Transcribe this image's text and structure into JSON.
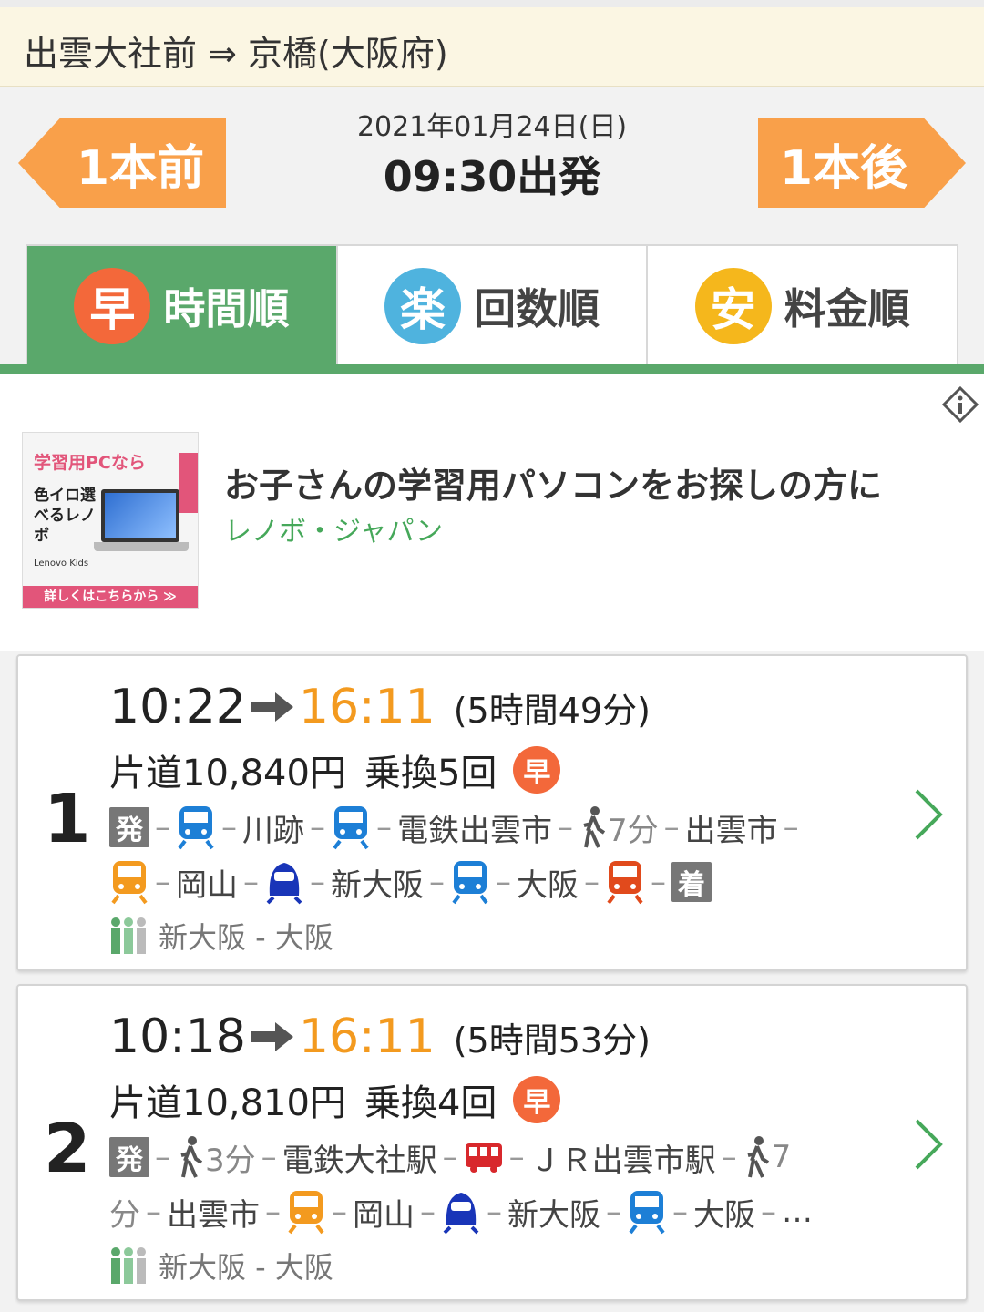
{
  "route": {
    "title": "出雲大社前 ⇒ 京橋(大阪府)"
  },
  "nav": {
    "prev_label": "1本前",
    "next_label": "1本後",
    "date": "2021年01月24日(日)",
    "time": "09:30出発"
  },
  "sort_tabs": [
    {
      "icon_char": "早",
      "label": "時間順",
      "active": true
    },
    {
      "icon_char": "楽",
      "label": "回数順",
      "active": false
    },
    {
      "icon_char": "安",
      "label": "料金順",
      "active": false
    }
  ],
  "ad": {
    "title": "お子さんの学習用パソコンをお探しの方に",
    "sponsor": "レノボ・ジャパン",
    "image_text_1": "学習用PCなら",
    "image_text_2": "色イロ選べるレノボ",
    "image_brand": "Lenovo Kids",
    "image_side": "Lenovo",
    "image_cta": "詳しくはこちらから ≫"
  },
  "results": [
    {
      "index": "1",
      "depart": "10:22",
      "arrive": "16:11",
      "duration": "(5時間49分)",
      "fare": "片道10,840円",
      "transfers": "乗換5回",
      "fast_char": "早",
      "dep_tag": "発",
      "arr_tag": "着",
      "stops": [
        "川跡",
        "電鉄出雲市",
        "7分",
        "出雲市",
        "岡山",
        "新大阪",
        "大阪"
      ],
      "seat_info": "新大阪 - 大阪"
    },
    {
      "index": "2",
      "depart": "10:18",
      "arrive": "16:11",
      "duration": "(5時間53分)",
      "fare": "片道10,810円",
      "transfers": "乗換4回",
      "fast_char": "早",
      "dep_tag": "発",
      "stops": [
        "3分",
        "電鉄大社駅",
        "ＪＲ出雲市駅",
        "7",
        "分",
        "出雲市",
        "岡山",
        "新大阪",
        "大阪",
        "…"
      ],
      "seat_info": "新大阪 - 大阪"
    }
  ],
  "colors": {
    "accent_green": "#5aa86b",
    "orange": "#f9a04a",
    "arrive_time": "#f39a1f",
    "blue_train": "#1d7fd6",
    "orange_train": "#f39a1f",
    "red_train": "#e14a1c",
    "shinkansen": "#1935b8"
  }
}
